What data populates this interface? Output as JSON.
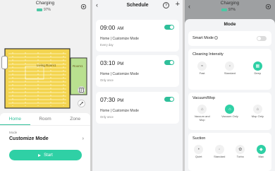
{
  "home": {
    "status_title": "Charging",
    "battery": "97%",
    "rooms": [
      "Living Room1",
      "Room1"
    ],
    "tabs": [
      "Home",
      "Room",
      "Zone"
    ],
    "mode_caption": "Mode",
    "mode_value": "Customize Mode",
    "start_label": "Start",
    "colors": {
      "accent": "#2fd0a5",
      "map_fill": "#f3d44f",
      "room_fill": "#b9e08f"
    }
  },
  "schedule": {
    "title": "Schedule",
    "help_glyph": "?",
    "items": [
      {
        "time": "09:00",
        "ampm": "AM",
        "crumb": "Home  |  Customize Mode",
        "repeat": "Every day"
      },
      {
        "time": "03:10",
        "ampm": "PM",
        "crumb": "Home  |  Customize Mode",
        "repeat": "Only once"
      },
      {
        "time": "07:30",
        "ampm": "PM",
        "crumb": "Home  |  Customize Mode",
        "repeat": "Only once"
      }
    ]
  },
  "mode_sheet": {
    "status_title": "Charging",
    "battery": "97%",
    "title": "Mode",
    "smart_mode": {
      "label": "Smart Mode",
      "enabled": false
    },
    "cleaning_intensity": {
      "label": "Cleaning Intensity",
      "options": [
        "Fast",
        "Standard",
        "Deep"
      ],
      "selected": "Deep"
    },
    "vacuum_mop": {
      "label": "Vacuum/Mop",
      "options": [
        "Vacuum and Mop",
        "Vacuum Only",
        "Mop Only"
      ],
      "selected": "Vacuum Only"
    },
    "suction": {
      "label": "Suction",
      "options": [
        "Quiet",
        "Standard",
        "Turbo",
        "Max"
      ],
      "selected": "Max"
    }
  }
}
